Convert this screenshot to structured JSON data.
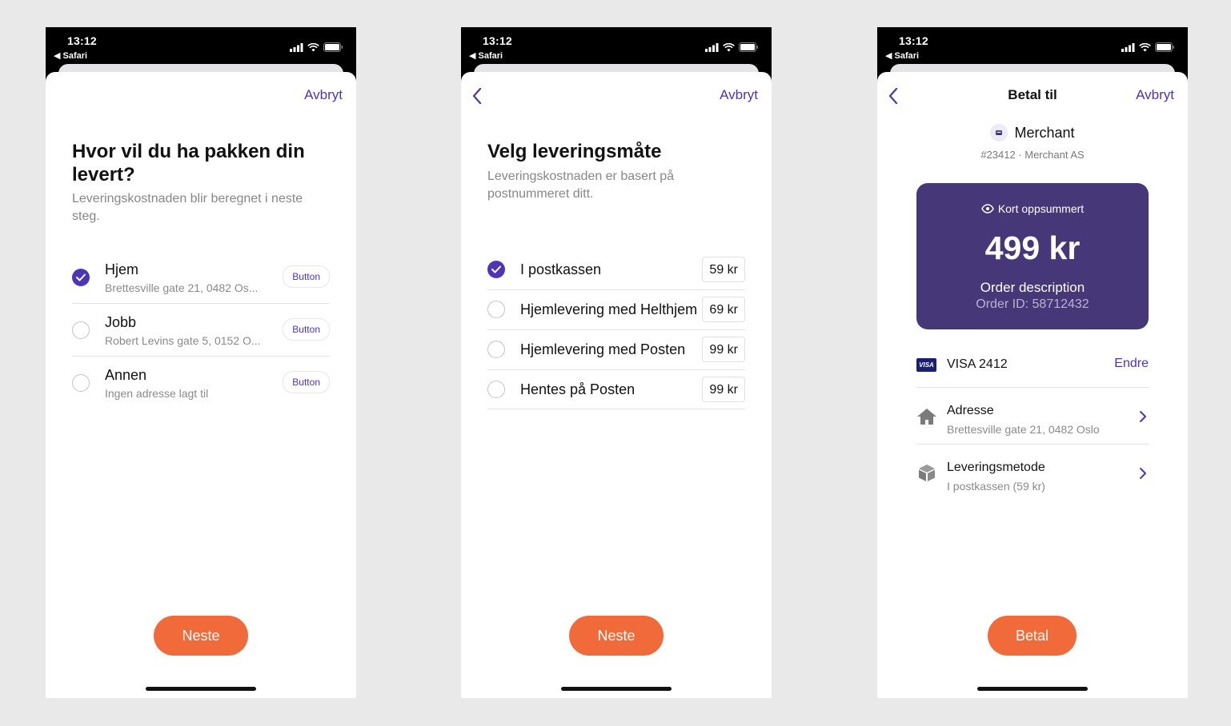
{
  "status_bar": {
    "time": "13:12",
    "back_app": "◀ Safari"
  },
  "colors": {
    "accent": "#4d35b4",
    "cta": "#f06a3a",
    "card": "#463779"
  },
  "screen1": {
    "cancel": "Avbryt",
    "title": "Hvor vil du ha pakken din levert?",
    "subtitle": "Leveringskostnaden blir beregnet i neste steg.",
    "addresses": [
      {
        "name": "Hjem",
        "address": "Brettesville gate 21, 0482 Os...",
        "button": "Button",
        "selected": true
      },
      {
        "name": "Jobb",
        "address": "Robert Levins gate 5, 0152 O...",
        "button": "Button",
        "selected": false
      },
      {
        "name": "Annen",
        "address": "Ingen adresse lagt til",
        "button": "Button",
        "selected": false
      }
    ],
    "next": "Neste"
  },
  "screen2": {
    "cancel": "Avbryt",
    "title": "Velg leveringsmåte",
    "subtitle": "Leveringskostnaden er basert på postnummeret ditt.",
    "options": [
      {
        "label": "I postkassen",
        "price": "59 kr",
        "selected": true
      },
      {
        "label": "Hjemlevering med Helthjem",
        "price": "69 kr",
        "selected": false
      },
      {
        "label": "Hjemlevering med Posten",
        "price": "99 kr",
        "selected": false
      },
      {
        "label": "Hentes på Posten",
        "price": "99 kr",
        "selected": false
      }
    ],
    "next": "Neste"
  },
  "screen3": {
    "title": "Betal til",
    "cancel": "Avbryt",
    "merchant": {
      "name": "Merchant",
      "meta": "#23412 · Merchant AS"
    },
    "card": {
      "header": "Kort oppsummert",
      "amount": "499 kr",
      "description": "Order description",
      "order_id": "Order ID: 58712432"
    },
    "payment": {
      "card_brand": "VISA",
      "card_label": "VISA 2412",
      "change": "Endre"
    },
    "address": {
      "title": "Adresse",
      "value": "Brettesville gate 21, 0482 Oslo"
    },
    "delivery": {
      "title": "Leveringsmetode",
      "value": "I postkassen (59 kr)"
    },
    "pay": "Betal"
  }
}
